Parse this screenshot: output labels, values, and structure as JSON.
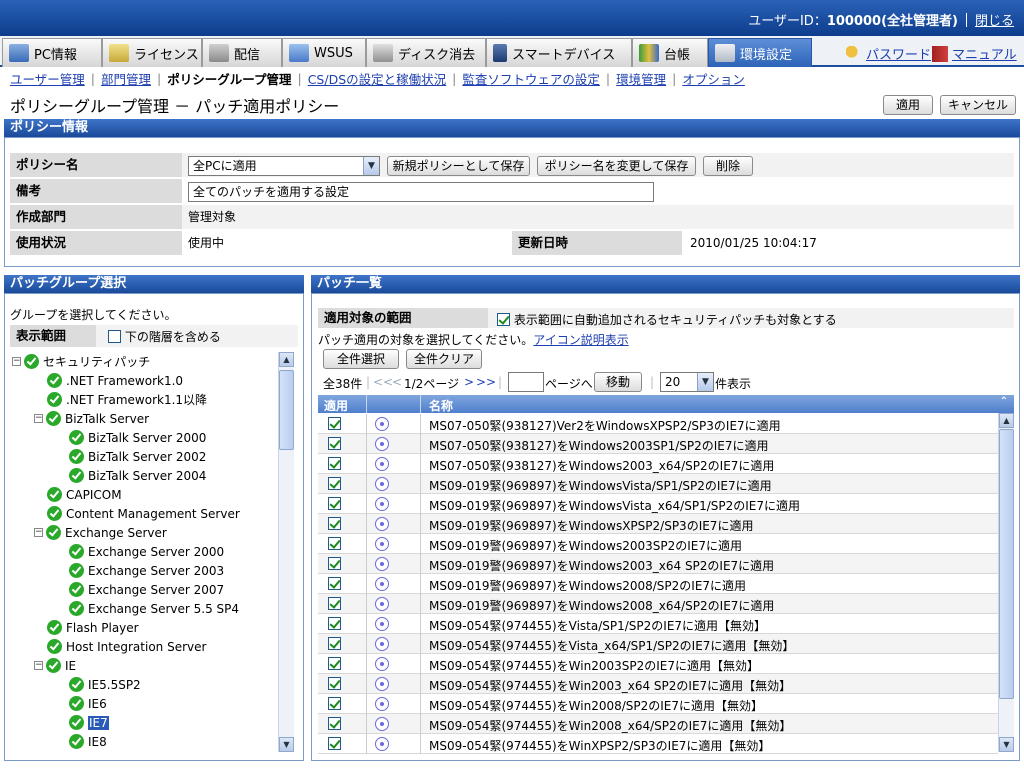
{
  "header": {
    "user_label": "ユーザーID：",
    "user_id": "100000(全社管理者)",
    "logout": "閉じる"
  },
  "tabs": [
    {
      "label": "PC情報",
      "icon": "pc-icon"
    },
    {
      "label": "ライセンス",
      "icon": "license-icon"
    },
    {
      "label": "配信",
      "icon": "delivery-icon"
    },
    {
      "label": "WSUS",
      "icon": "wsus-icon"
    },
    {
      "label": "ディスク消去",
      "icon": "disk-erase-icon"
    },
    {
      "label": "スマートデバイス",
      "icon": "smart-device-icon"
    },
    {
      "label": "台帳",
      "icon": "ledger-icon"
    },
    {
      "label": "環境設定",
      "icon": "settings-icon",
      "active": true
    }
  ],
  "header_links": {
    "password": "パスワード",
    "manual": "マニュアル"
  },
  "subnav": [
    "ユーザー管理",
    "部門管理",
    "ポリシーグループ管理",
    "CS/DSの設定と稼働状況",
    "監査ソフトウェアの設定",
    "環境管理",
    "オプション"
  ],
  "page": {
    "title": "ポリシーグループ管理 － パッチ適用ポリシー",
    "apply": "適用",
    "cancel": "キャンセル"
  },
  "policy": {
    "section_title": "ポリシー情報",
    "name_label": "ポリシー名",
    "name_value": "全PCに適用",
    "save_new": "新規ポリシーとして保存",
    "rename_save": "ポリシー名を変更して保存",
    "delete": "削除",
    "note_label": "備考",
    "note_value": "全てのパッチを適用する設定",
    "dept_label": "作成部門",
    "dept_value": "管理対象",
    "status_label": "使用状況",
    "status_value": "使用中",
    "updated_label": "更新日時",
    "updated_value": "2010/01/25 10:04:17"
  },
  "group_panel": {
    "title": "パッチグループ選択",
    "instruction": "グループを選択してください。",
    "scope_label": "表示範囲",
    "include_sub": "下の階層を含める",
    "tree": [
      {
        "label": "セキュリティパッチ",
        "level": 0,
        "expander": "−"
      },
      {
        "label": ".NET Framework1.0",
        "level": 1
      },
      {
        "label": ".NET Framework1.1以降",
        "level": 1
      },
      {
        "label": "BizTalk Server",
        "level": 1,
        "expander": "−"
      },
      {
        "label": "BizTalk Server 2000",
        "level": 2
      },
      {
        "label": "BizTalk Server 2002",
        "level": 2
      },
      {
        "label": "BizTalk Server 2004",
        "level": 2
      },
      {
        "label": "CAPICOM",
        "level": 1
      },
      {
        "label": "Content Management Server",
        "level": 1
      },
      {
        "label": "Exchange Server",
        "level": 1,
        "expander": "−"
      },
      {
        "label": "Exchange Server 2000",
        "level": 2
      },
      {
        "label": "Exchange Server 2003",
        "level": 2
      },
      {
        "label": "Exchange Server 2007",
        "level": 2
      },
      {
        "label": "Exchange Server 5.5 SP4",
        "level": 2
      },
      {
        "label": "Flash Player",
        "level": 1
      },
      {
        "label": "Host Integration Server",
        "level": 1
      },
      {
        "label": "IE",
        "level": 1,
        "expander": "−"
      },
      {
        "label": "IE5.5SP2",
        "level": 2
      },
      {
        "label": "IE6",
        "level": 2
      },
      {
        "label": "IE7",
        "level": 2,
        "selected": true
      },
      {
        "label": "IE8",
        "level": 2
      }
    ]
  },
  "patch_panel": {
    "title": "パッチ一覧",
    "scope_label": "適用対象の範囲",
    "auto_add": "表示範囲に自動追加されるセキュリティパッチも対象とする",
    "instruction": "パッチ適用の対象を選択してください。",
    "icon_help": "アイコン説明表示",
    "select_all": "全件選択",
    "clear_all": "全件クリア",
    "total": "全38件",
    "first": "<<",
    "prev": "<",
    "page_info": "1/2ページ",
    "next": ">",
    "last": ">>",
    "page_input": "",
    "goto_label": "ページへ",
    "move": "移動",
    "per_page": "20",
    "per_page_suffix": "件表示",
    "col_apply": "適用",
    "col_name": "名称",
    "rows": [
      "MS07-050緊(938127)Ver2をWindowsXPSP2/SP3のIE7に適用",
      "MS07-050緊(938127)をWindows2003SP1/SP2のIE7に適用",
      "MS07-050緊(938127)をWindows2003_x64/SP2のIE7に適用",
      "MS09-019緊(969897)をWindowsVista/SP1/SP2のIE7に適用",
      "MS09-019緊(969897)をWindowsVista_x64/SP1/SP2のIE7に適用",
      "MS09-019緊(969897)をWindowsXPSP2/SP3のIE7に適用",
      "MS09-019警(969897)をWindows2003SP2のIE7に適用",
      "MS09-019警(969897)をWindows2003_x64 SP2のIE7に適用",
      "MS09-019警(969897)をWindows2008/SP2のIE7に適用",
      "MS09-019警(969897)をWindows2008_x64/SP2のIE7に適用",
      "MS09-054緊(974455)をVista/SP1/SP2のIE7に適用【無効】",
      "MS09-054緊(974455)をVista_x64/SP1/SP2のIE7に適用【無効】",
      "MS09-054緊(974455)をWin2003SP2のIE7に適用【無効】",
      "MS09-054緊(974455)をWin2003_x64 SP2のIE7に適用【無効】",
      "MS09-054緊(974455)をWin2008/SP2のIE7に適用【無効】",
      "MS09-054緊(974455)をWin2008_x64/SP2のIE7に適用【無効】",
      "MS09-054緊(974455)をWinXPSP2/SP3のIE7に適用【無効】"
    ]
  }
}
